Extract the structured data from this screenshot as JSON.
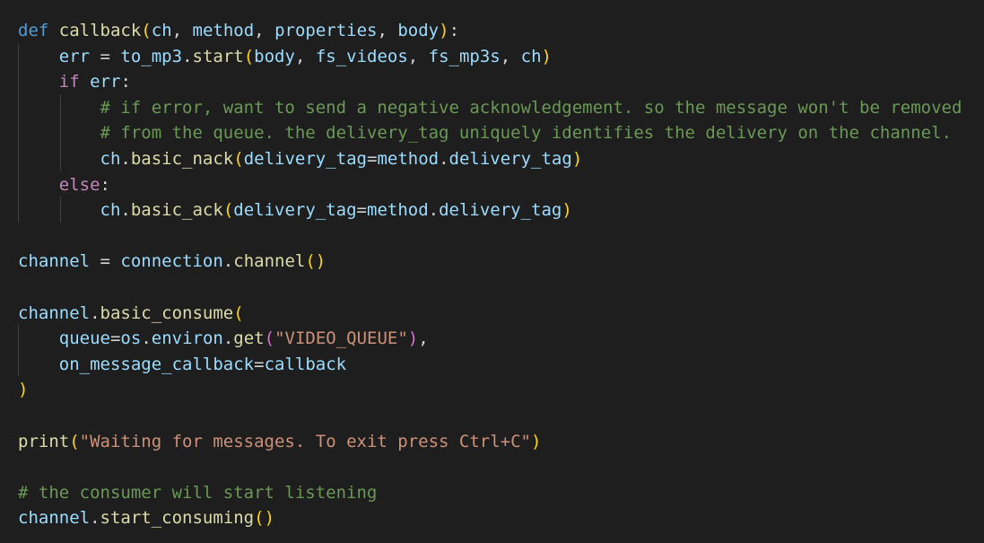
{
  "editor": {
    "theme_colors": {
      "background": "#1e1e1e",
      "keyword_def": "#569cd6",
      "keyword_control": "#c586c0",
      "function": "#dcdcaa",
      "variable": "#9cdcfe",
      "string": "#ce9178",
      "comment": "#6a9955",
      "bracket_level1": "#ffd700",
      "bracket_level2": "#da70d6"
    },
    "lines": [
      {
        "tokens": [
          {
            "t": "def",
            "c": "kw-def"
          },
          {
            "t": " ",
            "c": "punc"
          },
          {
            "t": "callback",
            "c": "fn"
          },
          {
            "t": "(",
            "c": "br1"
          },
          {
            "t": "ch",
            "c": "var"
          },
          {
            "t": ", ",
            "c": "punc"
          },
          {
            "t": "method",
            "c": "var"
          },
          {
            "t": ", ",
            "c": "punc"
          },
          {
            "t": "properties",
            "c": "var"
          },
          {
            "t": ", ",
            "c": "punc"
          },
          {
            "t": "body",
            "c": "var"
          },
          {
            "t": ")",
            "c": "br1"
          },
          {
            "t": ":",
            "c": "punc"
          }
        ]
      },
      {
        "tokens": [
          {
            "t": "    ",
            "c": "punc"
          },
          {
            "t": "err",
            "c": "var"
          },
          {
            "t": " = ",
            "c": "punc"
          },
          {
            "t": "to_mp3",
            "c": "var"
          },
          {
            "t": ".",
            "c": "punc"
          },
          {
            "t": "start",
            "c": "fn"
          },
          {
            "t": "(",
            "c": "br1"
          },
          {
            "t": "body",
            "c": "var"
          },
          {
            "t": ", ",
            "c": "punc"
          },
          {
            "t": "fs_videos",
            "c": "var"
          },
          {
            "t": ", ",
            "c": "punc"
          },
          {
            "t": "fs_mp3s",
            "c": "var"
          },
          {
            "t": ", ",
            "c": "punc"
          },
          {
            "t": "ch",
            "c": "var"
          },
          {
            "t": ")",
            "c": "br1"
          }
        ]
      },
      {
        "tokens": [
          {
            "t": "    ",
            "c": "punc"
          },
          {
            "t": "if",
            "c": "kw-ctl"
          },
          {
            "t": " ",
            "c": "punc"
          },
          {
            "t": "err",
            "c": "var"
          },
          {
            "t": ":",
            "c": "punc"
          }
        ]
      },
      {
        "tokens": [
          {
            "t": "        ",
            "c": "punc"
          },
          {
            "t": "# if error, want to send a negative acknowledgement. so the message won't be removed",
            "c": "cmt"
          }
        ]
      },
      {
        "tokens": [
          {
            "t": "        ",
            "c": "punc"
          },
          {
            "t": "# from the queue. the delivery_tag uniquely identifies the delivery on the channel.",
            "c": "cmt"
          }
        ]
      },
      {
        "tokens": [
          {
            "t": "        ",
            "c": "punc"
          },
          {
            "t": "ch",
            "c": "var"
          },
          {
            "t": ".",
            "c": "punc"
          },
          {
            "t": "basic_nack",
            "c": "fn"
          },
          {
            "t": "(",
            "c": "br1"
          },
          {
            "t": "delivery_tag",
            "c": "var"
          },
          {
            "t": "=",
            "c": "punc"
          },
          {
            "t": "method",
            "c": "var"
          },
          {
            "t": ".",
            "c": "punc"
          },
          {
            "t": "delivery_tag",
            "c": "var"
          },
          {
            "t": ")",
            "c": "br1"
          }
        ]
      },
      {
        "tokens": [
          {
            "t": "    ",
            "c": "punc"
          },
          {
            "t": "else",
            "c": "kw-ctl"
          },
          {
            "t": ":",
            "c": "punc"
          }
        ]
      },
      {
        "tokens": [
          {
            "t": "        ",
            "c": "punc"
          },
          {
            "t": "ch",
            "c": "var"
          },
          {
            "t": ".",
            "c": "punc"
          },
          {
            "t": "basic_ack",
            "c": "fn"
          },
          {
            "t": "(",
            "c": "br1"
          },
          {
            "t": "delivery_tag",
            "c": "var"
          },
          {
            "t": "=",
            "c": "punc"
          },
          {
            "t": "method",
            "c": "var"
          },
          {
            "t": ".",
            "c": "punc"
          },
          {
            "t": "delivery_tag",
            "c": "var"
          },
          {
            "t": ")",
            "c": "br1"
          }
        ]
      },
      {
        "tokens": []
      },
      {
        "tokens": [
          {
            "t": "channel",
            "c": "var"
          },
          {
            "t": " = ",
            "c": "punc"
          },
          {
            "t": "connection",
            "c": "var"
          },
          {
            "t": ".",
            "c": "punc"
          },
          {
            "t": "channel",
            "c": "fn"
          },
          {
            "t": "()",
            "c": "br1"
          }
        ]
      },
      {
        "tokens": []
      },
      {
        "tokens": [
          {
            "t": "channel",
            "c": "var"
          },
          {
            "t": ".",
            "c": "punc"
          },
          {
            "t": "basic_consume",
            "c": "fn"
          },
          {
            "t": "(",
            "c": "br1"
          }
        ]
      },
      {
        "tokens": [
          {
            "t": "    ",
            "c": "punc"
          },
          {
            "t": "queue",
            "c": "var"
          },
          {
            "t": "=",
            "c": "punc"
          },
          {
            "t": "os",
            "c": "var"
          },
          {
            "t": ".",
            "c": "punc"
          },
          {
            "t": "environ",
            "c": "var"
          },
          {
            "t": ".",
            "c": "punc"
          },
          {
            "t": "get",
            "c": "fn"
          },
          {
            "t": "(",
            "c": "br2"
          },
          {
            "t": "\"VIDEO_QUEUE\"",
            "c": "str"
          },
          {
            "t": ")",
            "c": "br2"
          },
          {
            "t": ",",
            "c": "punc"
          }
        ]
      },
      {
        "tokens": [
          {
            "t": "    ",
            "c": "punc"
          },
          {
            "t": "on_message_callback",
            "c": "var"
          },
          {
            "t": "=",
            "c": "punc"
          },
          {
            "t": "callback",
            "c": "var"
          }
        ]
      },
      {
        "tokens": [
          {
            "t": ")",
            "c": "br1"
          }
        ]
      },
      {
        "tokens": []
      },
      {
        "tokens": [
          {
            "t": "print",
            "c": "fn"
          },
          {
            "t": "(",
            "c": "br1"
          },
          {
            "t": "\"Waiting for messages. To exit press Ctrl+C\"",
            "c": "str"
          },
          {
            "t": ")",
            "c": "br1"
          }
        ]
      },
      {
        "tokens": []
      },
      {
        "tokens": [
          {
            "t": "# the consumer will start listening",
            "c": "cmt"
          }
        ]
      },
      {
        "tokens": [
          {
            "t": "channel",
            "c": "var"
          },
          {
            "t": ".",
            "c": "punc"
          },
          {
            "t": "start_consuming",
            "c": "fn"
          },
          {
            "t": "()",
            "c": "br1"
          }
        ]
      }
    ]
  }
}
